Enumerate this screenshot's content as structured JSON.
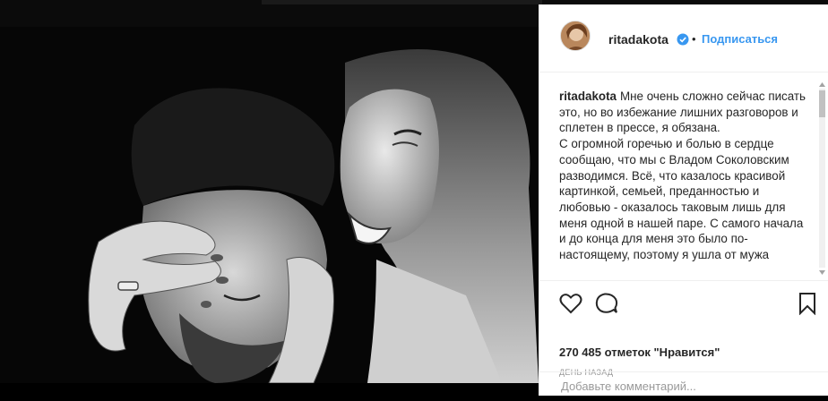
{
  "post": {
    "username": "ritadakota",
    "verified": true,
    "separator": "•",
    "follow_label": "Подписаться",
    "caption_author": "ritadakota",
    "caption_lines": [
      "Мне очень сложно сейчас писать это, но во избежание лишних разговоров и сплетен в прессе, я обязана.",
      "С огромной горечью и болью в сердце сообщаю, что мы с Владом Соколовским разводимся. Всё, что казалось красивой картинкой, семьей, преданностью и любовью - оказалось таковым лишь для меня одной в нашей паре. С самого начала и до конца для меня это было по-настоящему, поэтому я ушла от мужа"
    ],
    "likes_text": "270 485 отметок \"Нравится\"",
    "time_text": "ДЕНЬ НАЗАД",
    "comment_placeholder": "Добавьте комментарий...",
    "photo_description_icon": "photo-black-and-white"
  },
  "icons": {
    "like": "heart-icon",
    "comment": "comment-icon",
    "save": "bookmark-icon",
    "verified": "verified-badge-icon"
  },
  "colors": {
    "link": "#3897f0",
    "text": "#262626",
    "muted": "#999999",
    "border": "#efefef"
  }
}
